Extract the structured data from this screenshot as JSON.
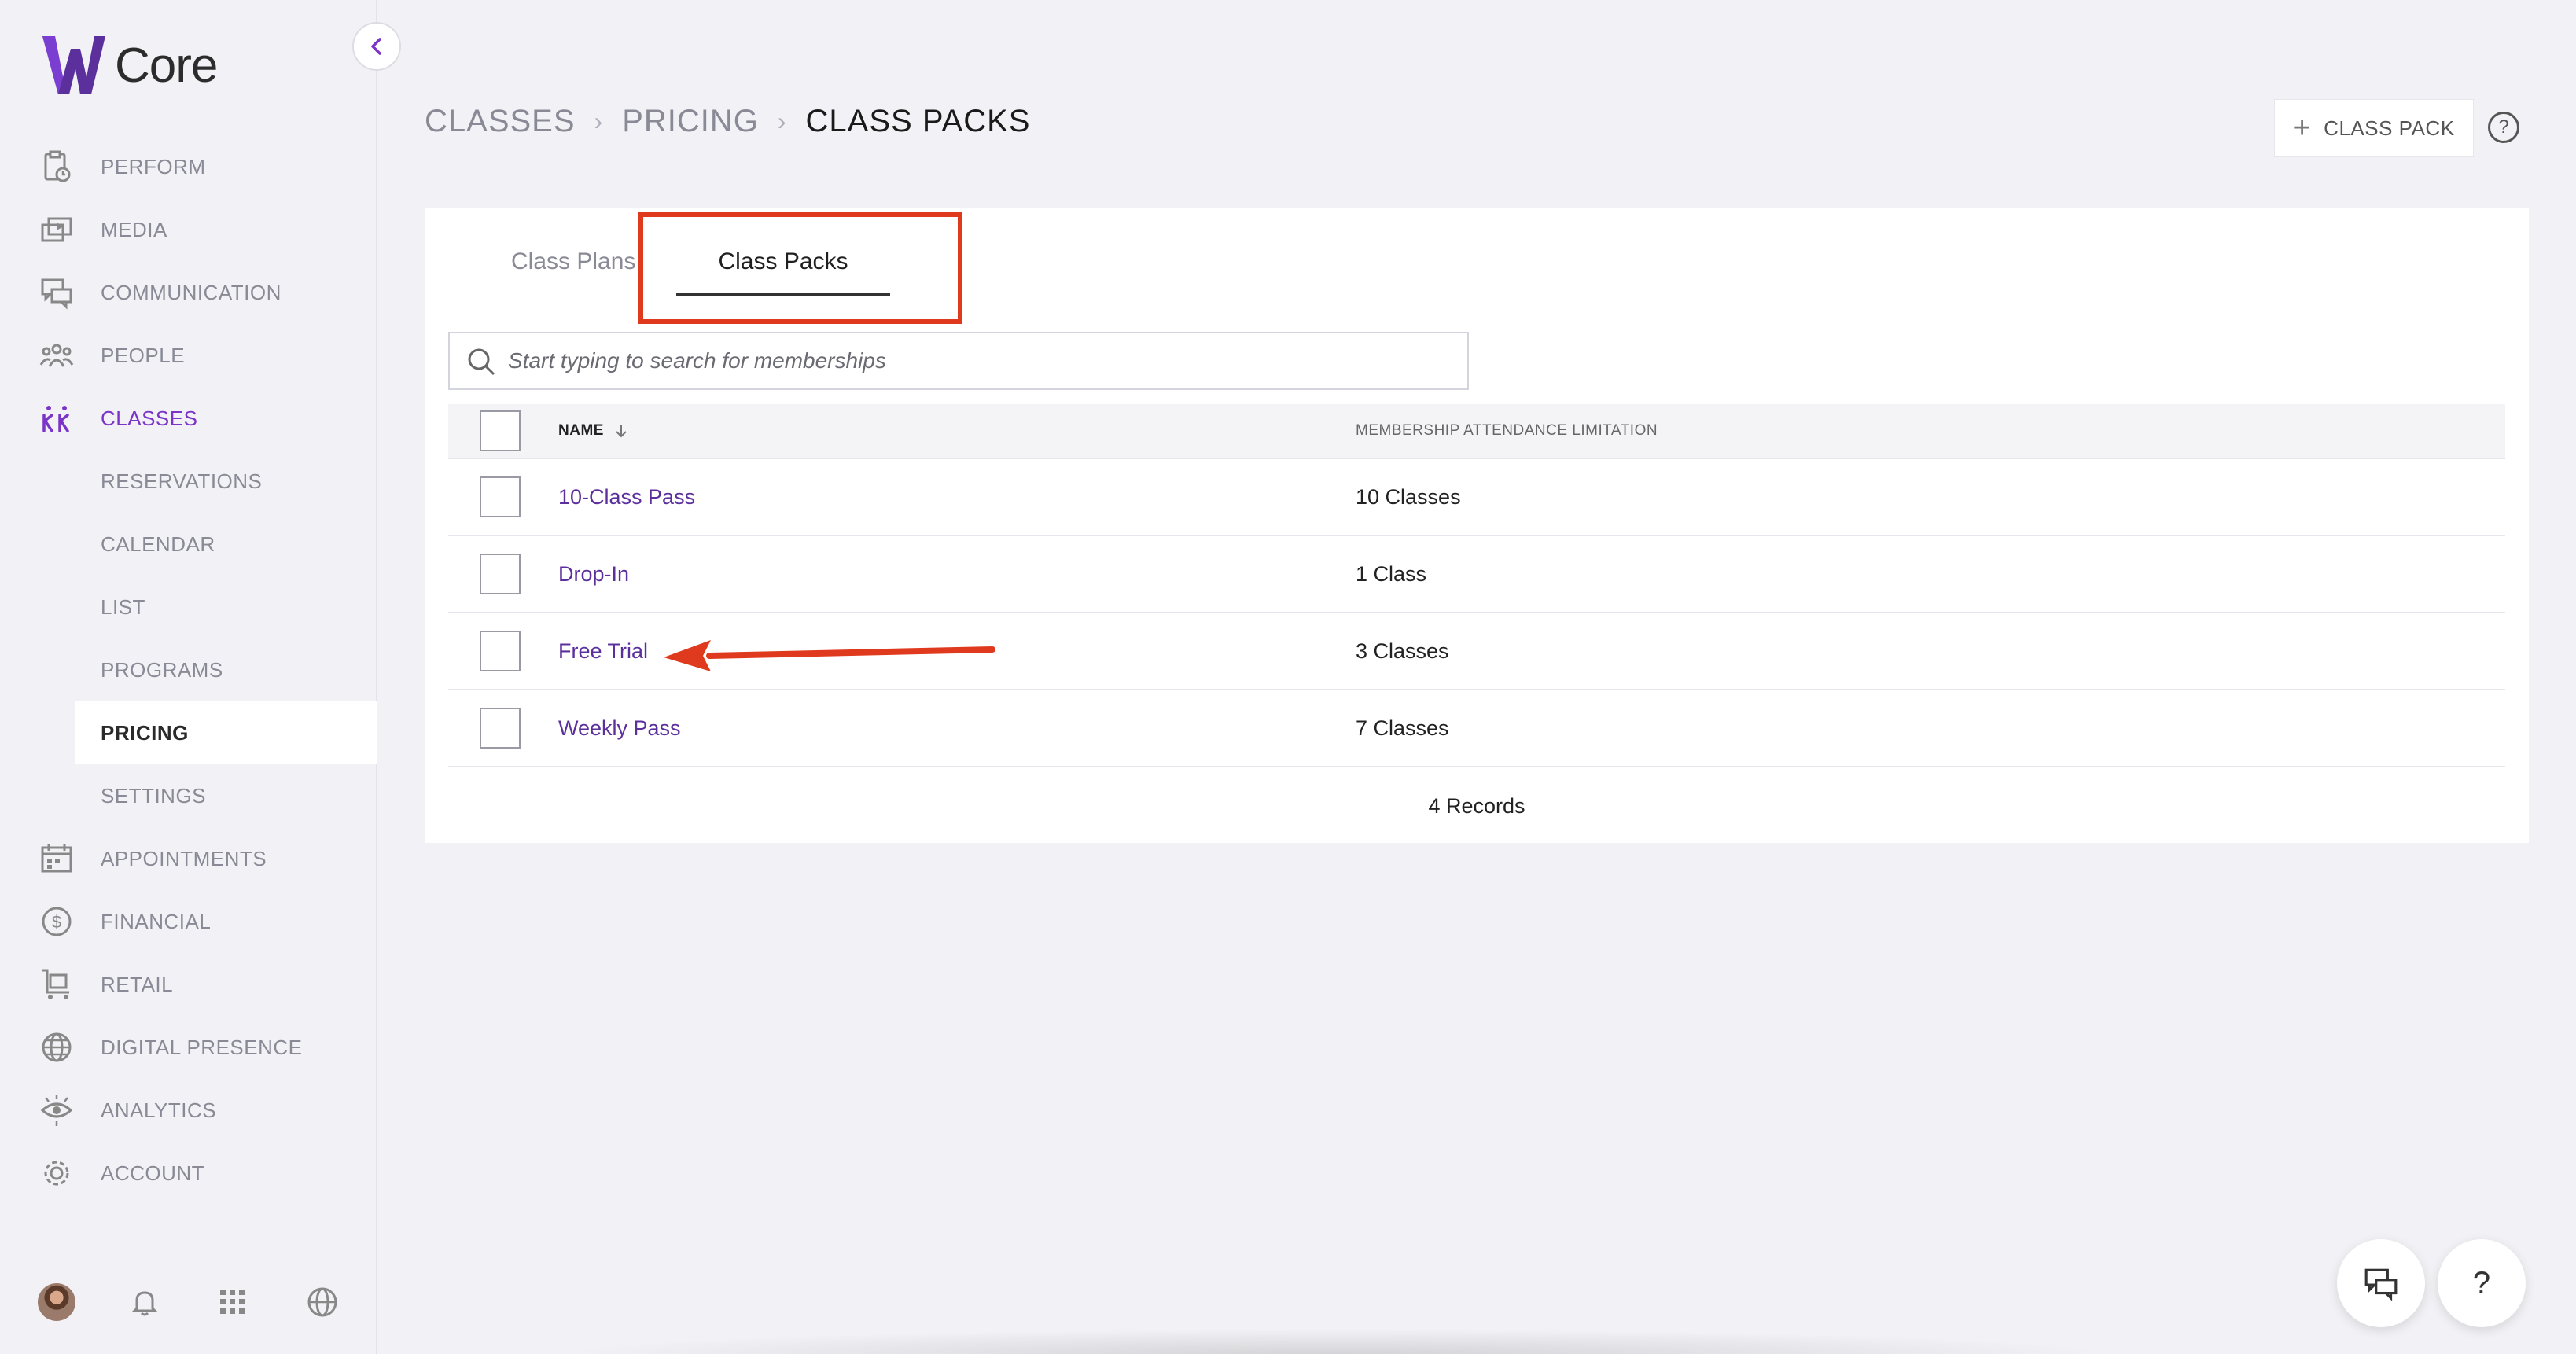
{
  "app": {
    "logo_text": "Core",
    "brand_color": "#5b2f9c",
    "accent_color": "#7a35c8",
    "highlight_color": "#e03a1e"
  },
  "sidebar": {
    "items": [
      {
        "label": "PERFORM",
        "icon": "clipboard-clock-icon"
      },
      {
        "label": "MEDIA",
        "icon": "media-play-icon"
      },
      {
        "label": "COMMUNICATION",
        "icon": "chat-bubbles-icon"
      },
      {
        "label": "PEOPLE",
        "icon": "people-icon"
      },
      {
        "label": "CLASSES",
        "icon": "classes-figures-icon",
        "active": true
      }
    ],
    "sub_items": [
      "RESERVATIONS",
      "CALENDAR",
      "LIST",
      "PROGRAMS",
      "PRICING",
      "SETTINGS"
    ],
    "selected_sub": "PRICING",
    "items_after": [
      {
        "label": "APPOINTMENTS",
        "icon": "calendar-icon"
      },
      {
        "label": "FINANCIAL",
        "icon": "dollar-circle-icon"
      },
      {
        "label": "RETAIL",
        "icon": "cart-icon"
      },
      {
        "label": "DIGITAL PRESENCE",
        "icon": "globe-icon"
      },
      {
        "label": "ANALYTICS",
        "icon": "eye-icon"
      },
      {
        "label": "ACCOUNT",
        "icon": "gear-icon"
      }
    ]
  },
  "header": {
    "breadcrumb": [
      "CLASSES",
      "PRICING",
      "CLASS PACKS"
    ],
    "add_button": "CLASS PACK",
    "help": "?"
  },
  "tabs": {
    "tab1": "Class Plans",
    "tab2": "Class Packs",
    "active": "Class Packs"
  },
  "search": {
    "placeholder": "Start typing to search for memberships"
  },
  "table": {
    "columns": {
      "name": "NAME",
      "limit": "MEMBERSHIP ATTENDANCE LIMITATION"
    },
    "rows": [
      {
        "name": "10-Class Pass",
        "limit": "10 Classes"
      },
      {
        "name": "Drop-In",
        "limit": "1 Class"
      },
      {
        "name": "Free Trial",
        "limit": "3 Classes"
      },
      {
        "name": "Weekly Pass",
        "limit": "7 Classes"
      }
    ],
    "records": "4 Records"
  },
  "fab": {
    "help": "?"
  }
}
